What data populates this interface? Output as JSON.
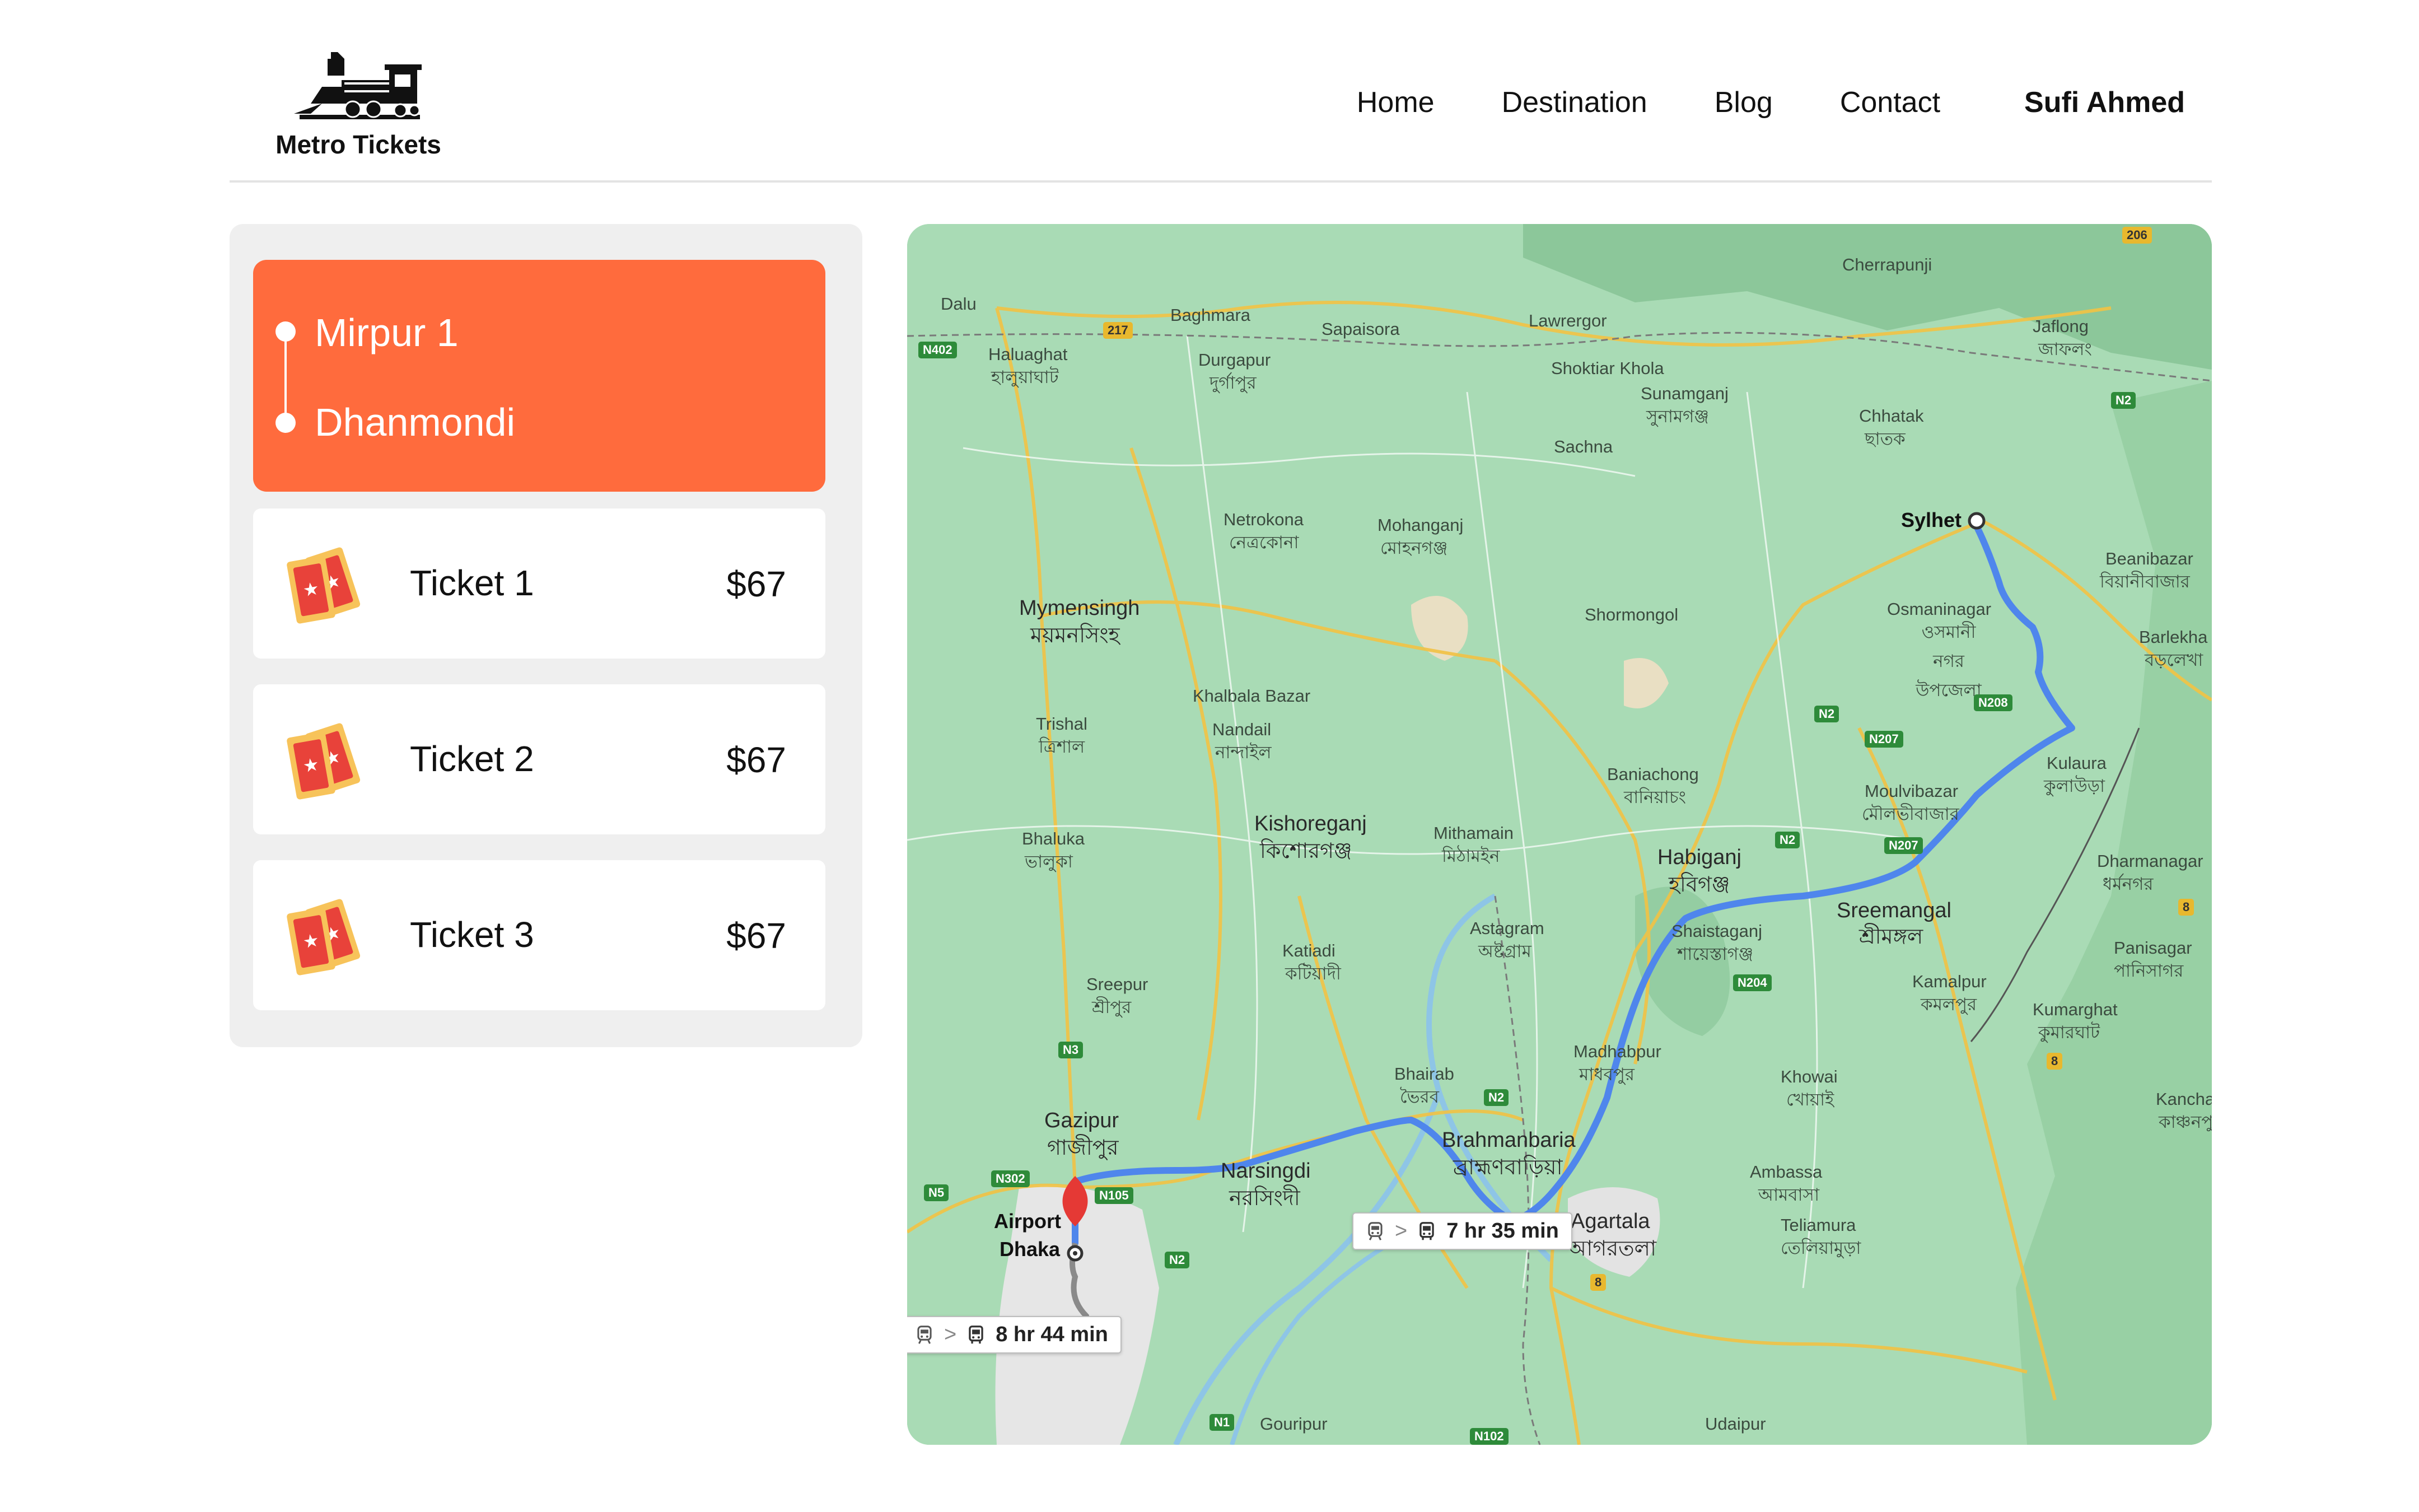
{
  "brand": {
    "name": "Metro Tickets",
    "icon": "train-icon"
  },
  "nav": {
    "items": [
      "Home",
      "Destination",
      "Blog",
      "Contact"
    ],
    "user": "Sufi Ahmed"
  },
  "route": {
    "from": "Mirpur 1",
    "to": "Dhanmondi"
  },
  "tickets": [
    {
      "name": "Ticket 1",
      "price": "$67",
      "icon": "ticket-icon"
    },
    {
      "name": "Ticket 2",
      "price": "$67",
      "icon": "ticket-icon"
    },
    {
      "name": "Ticket 3",
      "price": "$67",
      "icon": "ticket-icon"
    }
  ],
  "map": {
    "origin": "Dhaka",
    "origin_alt": "Airport",
    "destination": "Sylhet",
    "route_time_1": "7 hr 35 min",
    "route_time_2": "8 hr 44 min",
    "places": {
      "dalu": "Dalu",
      "baghmara": "Baghmara",
      "sapaisora": "Sapaisora",
      "lawrergor": "Lawrergor",
      "cherrapunji": "Cherrapunji",
      "jaflong": "Jaflong",
      "jaflong_bn": "জাফলং",
      "haluaghat": "Haluaghat",
      "haluaghat_bn": "হালুয়াঘাট",
      "durgapur": "Durgapur",
      "durgapur_bn": "দুর্গাপুর",
      "shoktiar_khola": "Shoktiar Khola",
      "sunamganj": "Sunamganj",
      "sunamganj_bn": "সুনামগঞ্জ",
      "chhatak": "Chhatak",
      "chhatak_bn": "ছাতক",
      "sachna": "Sachna",
      "netrokona": "Netrokona",
      "netrokona_bn": "নেত্রকোনা",
      "mohanganj": "Mohanganj",
      "mohanganj_bn": "মোহনগঞ্জ",
      "beanibazar": "Beanibazar",
      "beanibazar_bn": "বিয়ানীবাজার",
      "mymensingh": "Mymensingh",
      "mymensingh_bn": "ময়মনসিংহ",
      "shormongol": "Shormongol",
      "osmaninagar": "Osmaninagar",
      "osmaninagar_bn": "ওসমানী নগর উপজেলা",
      "barlekha": "Barlekha",
      "barlekha_bn": "বড়লেখা",
      "khalbala": "Khalbala Bazar",
      "trishal": "Trishal",
      "trishal_bn": "ত্রিশাল",
      "nandail": "Nandail",
      "nandail_bn": "নান্দাইল",
      "baniachong": "Baniachong",
      "baniachong_bn": "বানিয়াচং",
      "kulaura": "Kulaura",
      "kulaura_bn": "কুলাউড়া",
      "moulvibazar": "Moulvibazar",
      "moulvibazar_bn": "মৌলভীবাজার",
      "bhaluka": "Bhaluka",
      "bhaluka_bn": "ভালুকা",
      "kishoreganj": "Kishoreganj",
      "kishoreganj_bn": "কিশোরগঞ্জ",
      "mithamain": "Mithamain",
      "mithamain_bn": "মিঠামইন",
      "habiganj": "Habiganj",
      "habiganj_bn": "হবিগঞ্জ",
      "dharmanagar": "Dharmanagar",
      "dharmanagar_bn": "ধর্মনগর",
      "sreemangal": "Sreemangal",
      "sreemangal_bn": "শ্রীমঙ্গল",
      "astagram": "Astagram",
      "astagram_bn": "অষ্টগ্রাম",
      "shaistaganj": "Shaistaganj",
      "shaistaganj_bn": "শায়েস্তাগঞ্জ",
      "katiadi": "Katiadi",
      "katiadi_bn": "কটিয়াদী",
      "sreepur": "Sreepur",
      "sreepur_bn": "শ্রীপুর",
      "panisagar": "Panisagar",
      "panisagar_bn": "পানিসাগর",
      "kamalpur": "Kamalpur",
      "kamalpur_bn": "কমলপুর",
      "kumarghat": "Kumarghat",
      "kumarghat_bn": "কুমারঘাট",
      "madhabpur": "Madhabpur",
      "madhabpur_bn": "মাধবপুর",
      "bhairab": "Bhairab",
      "bhairab_bn": "ভৈরব",
      "khowai": "Khowai",
      "khowai_bn": "খোয়াই",
      "kanchanpur": "Kanchanp",
      "kanchanpur_bn": "কাঞ্চনপু",
      "gazipur": "Gazipur",
      "gazipur_bn": "গাজীপুর",
      "brahmanbaria": "Brahmanbaria",
      "brahmanbaria_bn": "ব্রাহ্মণবাড়িয়া",
      "narsingdi": "Narsingdi",
      "narsingdi_bn": "নরসিংদী",
      "ambassa": "Ambassa",
      "ambassa_bn": "আমবাসা",
      "agartala": "Agartala",
      "agartala_bn": "আগরতলা",
      "teliamura": "Teliamura",
      "teliamura_bn": "তেলিয়ামুড়া",
      "gouripur": "Gouripur",
      "udaipur": "Udaipur"
    },
    "roads": {
      "n402": "N402",
      "r217": "217",
      "n2a": "N2",
      "n2b": "N2",
      "n2c": "N2",
      "n2d": "N2",
      "n207a": "N207",
      "n207b": "N207",
      "n208": "N208",
      "n204": "N204",
      "n3": "N3",
      "n302": "N302",
      "n5": "N5",
      "n105": "N105",
      "n1": "N1",
      "n102": "N102",
      "r206": "206",
      "r8a": "8",
      "r8b": "8",
      "r8c": "8"
    }
  }
}
